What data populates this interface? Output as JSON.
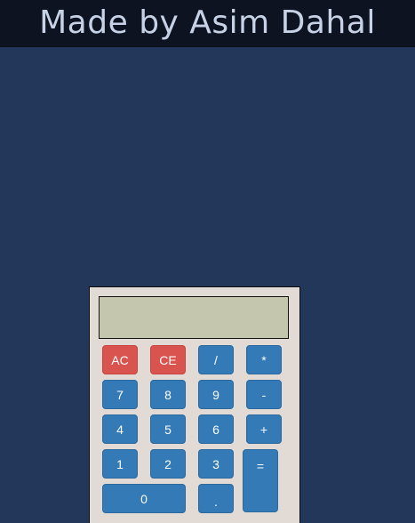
{
  "header": {
    "title": "Made by Asim Dahal"
  },
  "calculator": {
    "display_value": "",
    "buttons": {
      "all_clear": "AC",
      "clear_entry": "CE",
      "divide": "/",
      "multiply": "*",
      "seven": "7",
      "eight": "8",
      "nine": "9",
      "subtract": "-",
      "four": "4",
      "five": "5",
      "six": "6",
      "add": "+",
      "one": "1",
      "two": "2",
      "three": "3",
      "equals": "=",
      "zero": "0",
      "decimal": "."
    }
  },
  "colors": {
    "background": "#22375a",
    "header_background": "#0d1321",
    "header_text": "#c7d2e6",
    "calculator_body": "#e2dbd5",
    "display_background": "#c4c7ad",
    "button_blue": "#337ab7",
    "button_red": "#d9534f"
  }
}
